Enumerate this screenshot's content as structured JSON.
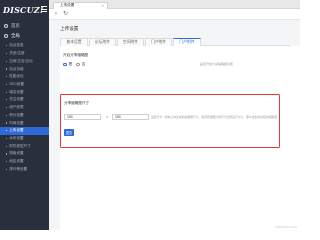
{
  "app": {
    "logo": "DISCUZ!"
  },
  "sidebar": {
    "top_items": [
      {
        "label": "首页",
        "icon": "home-icon"
      },
      {
        "label": "全局",
        "icon": "globe-icon"
      }
    ],
    "items": [
      {
        "label": "站点信息"
      },
      {
        "label": "关闭/注册"
      },
      {
        "label": "空间/交友/论坛"
      },
      {
        "label": "站点功能"
      },
      {
        "label": "性能优化"
      },
      {
        "label": "SEO设置"
      },
      {
        "label": "域名设置"
      },
      {
        "label": "关注设置"
      },
      {
        "label": "用户权限"
      },
      {
        "label": "积分设置"
      },
      {
        "label": "时间设置"
      },
      {
        "label": "上传设置",
        "active": true
      },
      {
        "label": "水印设置"
      },
      {
        "label": "附件类型尺寸"
      },
      {
        "label": "搜索设置"
      },
      {
        "label": "地区设置"
      },
      {
        "label": "排行榜设置"
      }
    ]
  },
  "tabs": {
    "current": "上传设置",
    "close": "×"
  },
  "toolbar": {
    "back": "‹",
    "refresh": "↻"
  },
  "page": {
    "title": "上传设置",
    "subtabs": [
      {
        "label": "基本设置"
      },
      {
        "label": "论坛附件"
      },
      {
        "label": "空间附件"
      },
      {
        "label": "门户附件",
        "active": false
      },
      {
        "label": "门户附件",
        "active": true
      }
    ],
    "section1": {
      "label": "开启分享缩略图",
      "options": [
        {
          "label": "是",
          "checked": true
        },
        {
          "label": "否",
          "checked": false
        }
      ],
      "hint": "是否开启分享缩略图功能"
    },
    "section2": {
      "label": "分享缩略图尺寸",
      "width": "150",
      "height": "150",
      "times": "×",
      "hint": "设置分享一篇帖子时生成的缩略图尺寸，如果原始图片的尺寸比所设尺寸大，那么会生成对应的缩略图",
      "submit": "提交"
    }
  },
  "watermark": "zhidaoxx.com",
  "colors": {
    "accent": "#2e6bd8",
    "sidebar": "#2a2f3d",
    "highlight": "#e03a3a"
  }
}
